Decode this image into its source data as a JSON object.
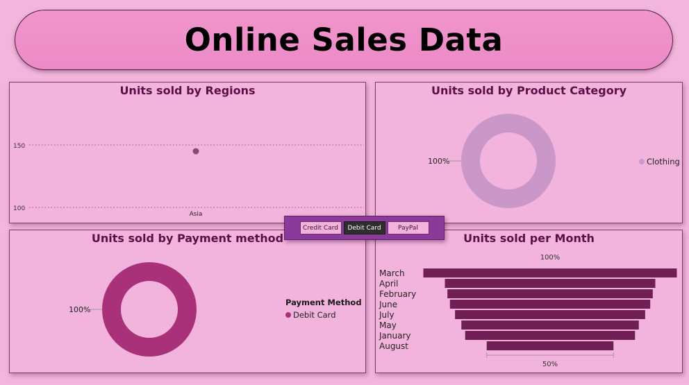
{
  "header": {
    "title": "Online Sales Data"
  },
  "slicer": {
    "options": [
      "Credit Card",
      "Debit Card",
      "PayPal"
    ],
    "selected": "Debit Card"
  },
  "colors": {
    "point": "#8a4a6e",
    "clothing": "#c998c9",
    "debit": "#a8317a",
    "funnel": "#6f1f54"
  },
  "panels": {
    "regions": {
      "title": "Units sold by Regions"
    },
    "category": {
      "title": "Units sold by Product Category",
      "legend": "Clothing",
      "label": "100%"
    },
    "payment": {
      "title": "Units sold by Payment method",
      "legend_title": "Payment Method",
      "legend": "Debit Card",
      "label": "100%"
    },
    "month": {
      "title": "Units sold per Month",
      "top_label": "100%",
      "bottom_label": "50%"
    }
  },
  "chart_data": [
    {
      "type": "scatter",
      "title": "Units sold by Regions",
      "categories": [
        "Asia"
      ],
      "values": [
        145
      ],
      "ylim": [
        100,
        150
      ],
      "yticks": [
        150,
        100
      ],
      "grid": true
    },
    {
      "type": "pie",
      "title": "Units sold by Product Category",
      "labels": [
        "Clothing"
      ],
      "values": [
        100
      ],
      "legend": "right"
    },
    {
      "type": "pie",
      "title": "Units sold by Payment method",
      "labels": [
        "Debit Card"
      ],
      "values": [
        100
      ],
      "legend_title": "Payment Method",
      "legend": "right"
    },
    {
      "type": "bar",
      "title": "Units sold per Month",
      "categories": [
        "March",
        "April",
        "February",
        "June",
        "July",
        "May",
        "January",
        "August"
      ],
      "values": [
        100,
        83,
        81,
        79,
        75,
        70,
        67,
        50
      ],
      "annotations": [
        "100%",
        "50%"
      ]
    }
  ]
}
